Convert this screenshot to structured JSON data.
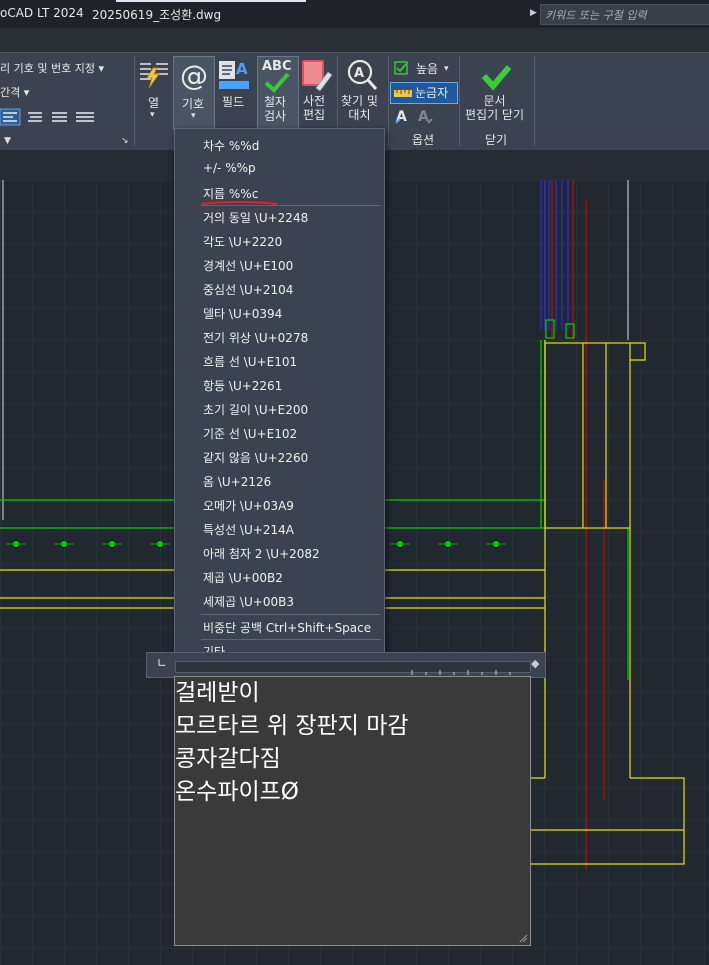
{
  "title_bar": {
    "app_title": "oCAD LT 2024",
    "document_tab": "20250619_조성환.dwg",
    "search_placeholder": "키워드 또는 구절 입력"
  },
  "ribbon": {
    "left_panel": {
      "line1": "리 기호 및 번호 지정 ▾",
      "line2": "간격 ▾"
    },
    "buttons": {
      "column": "열",
      "symbol": "기호",
      "field": "필드",
      "spell_check": "철자\n검사",
      "dictionary": "사전\n편집",
      "find_replace": "찾기 및\n대치",
      "close_editor": "문서\n편집기 닫기"
    },
    "options": {
      "height": "높음",
      "ruler": "눈금자",
      "panel_label": "옵션"
    },
    "close_panel_label": "닫기",
    "symbol_icon_text": "@",
    "abc_text": "ABC"
  },
  "symbol_menu": {
    "items": [
      "차수  %%d",
      "+/-  %%p",
      "지름  %%c",
      "거의 동일  \\U+2248",
      "각도  \\U+2220",
      "경계선  \\U+E100",
      "중심선  \\U+2104",
      "델타  \\U+0394",
      "전기 위상  \\U+0278",
      "흐름 선  \\U+E101",
      "항등  \\U+2261",
      "초기 길이  \\U+E200",
      "기준 선  \\U+E102",
      "같지 않음  \\U+2260",
      "옴  \\U+2126",
      "오메가  \\U+03A9",
      "특성선  \\U+214A",
      "아래 첨자 2  \\U+2082",
      "제곱  \\U+00B2",
      "세제곱  \\U+00B3",
      "비중단 공백  Ctrl+Shift+Space",
      "기타..."
    ],
    "highlight_color": "#e0242a"
  },
  "mtext": {
    "lines": [
      "걸레받이",
      "모르타르 위 장판지 마감",
      "콩자갈다짐",
      "온수파이프Ø"
    ]
  },
  "colors": {
    "canvas_bg": "#212830",
    "ribbon_bg": "#3b4350",
    "drawing_yellow": "#e3e300",
    "drawing_green": "#00d000",
    "drawing_red": "#e00000",
    "drawing_blue": "#2a2aff"
  }
}
